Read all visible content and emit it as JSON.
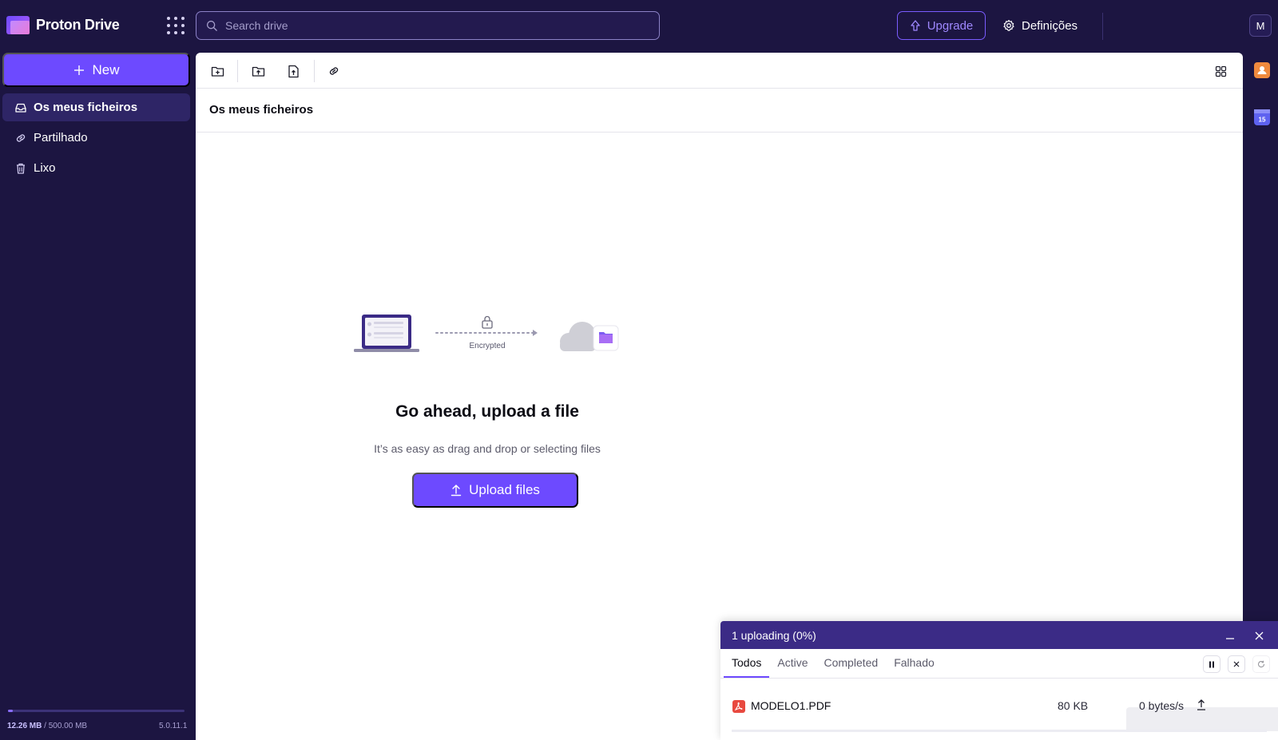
{
  "app": {
    "name": "Proton Drive"
  },
  "header": {
    "search_placeholder": "Search drive",
    "upgrade_label": "Upgrade",
    "settings_label": "Definições",
    "avatar_initial": "M"
  },
  "sidebar": {
    "new_label": "New",
    "items": [
      {
        "label": "Os meus ficheiros",
        "icon": "inbox-icon",
        "active": true
      },
      {
        "label": "Partilhado",
        "icon": "link-icon",
        "active": false
      },
      {
        "label": "Lixo",
        "icon": "trash-icon",
        "active": false
      }
    ],
    "storage": {
      "used": "12.26 MB",
      "separator": " / ",
      "total": "500.00 MB",
      "used_fraction": 0.025
    },
    "version": "5.0.11.1"
  },
  "toolbar": {
    "icons": [
      "new-folder-icon",
      "upload-folder-icon",
      "upload-file-icon",
      "share-link-icon"
    ],
    "layout_icon": "grid-view-icon"
  },
  "breadcrumb": {
    "current": "Os meus ficheiros"
  },
  "empty_state": {
    "illustration_label": "Encrypted",
    "title": "Go ahead, upload a file",
    "subtitle": "It’s as easy as drag and drop or selecting files",
    "upload_label": "Upload files"
  },
  "transfer_manager": {
    "title": "1 uploading (0%)",
    "tabs": [
      {
        "label": "Todos",
        "active": true
      },
      {
        "label": "Active",
        "active": false
      },
      {
        "label": "Completed",
        "active": false
      },
      {
        "label": "Falhado",
        "active": false
      }
    ],
    "files": [
      {
        "name": "MODELO1.PDF",
        "size": "80 KB",
        "speed": "0 bytes/s",
        "progress": 0.0
      }
    ]
  },
  "colors": {
    "background": "#1c1541",
    "accent": "#6d4aff",
    "transfer_header": "#3b2b86",
    "pdf_icon": "#e8493f"
  }
}
